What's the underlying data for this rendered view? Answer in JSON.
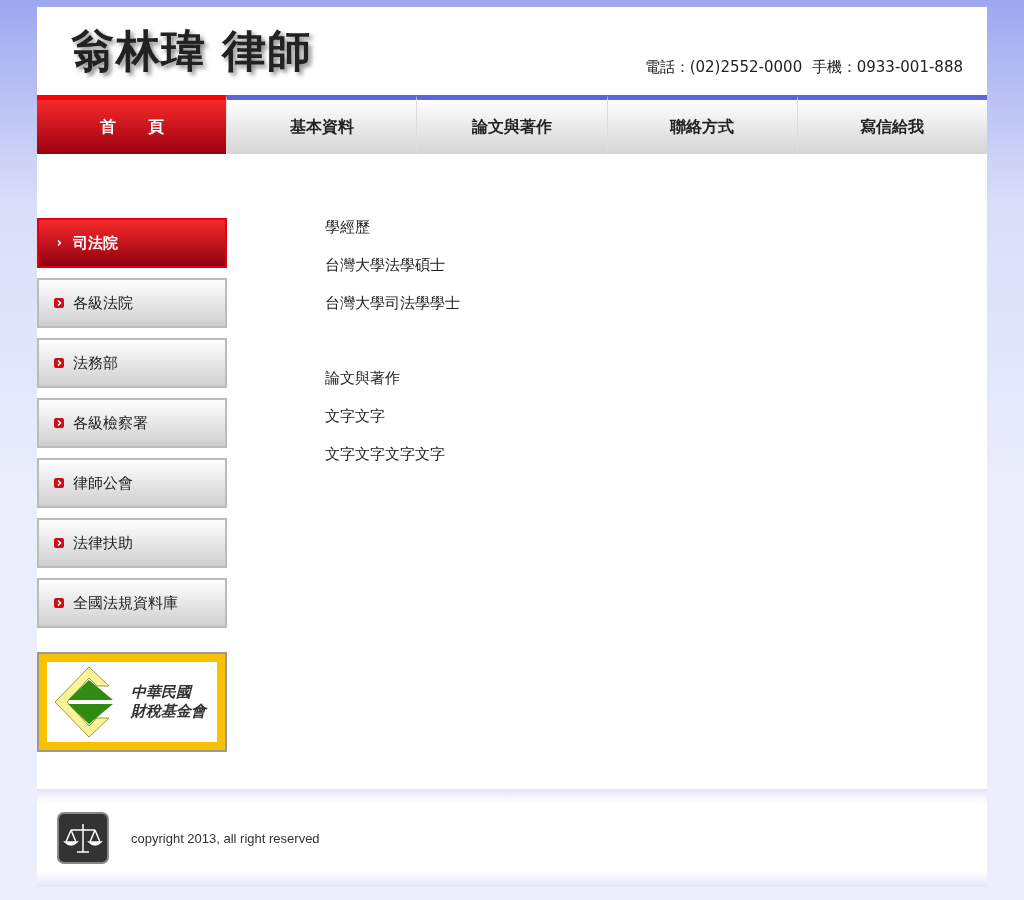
{
  "header": {
    "title": "翁林瑋 律師",
    "contact": "電話：(02)2552-0000  手機：0933-001-888"
  },
  "nav": [
    {
      "label": "首　　頁",
      "selected": true
    },
    {
      "label": "基本資料",
      "selected": false
    },
    {
      "label": "論文與著作",
      "selected": false
    },
    {
      "label": "聯絡方式",
      "selected": false
    },
    {
      "label": "寫信給我",
      "selected": false
    }
  ],
  "sidebar": {
    "items": [
      {
        "label": "司法院",
        "selected": true
      },
      {
        "label": "各級法院",
        "selected": false
      },
      {
        "label": "法務部",
        "selected": false
      },
      {
        "label": "各級檢察署",
        "selected": false
      },
      {
        "label": "律師公會",
        "selected": false
      },
      {
        "label": "法律扶助",
        "selected": false
      },
      {
        "label": "全國法規資料庫",
        "selected": false
      }
    ],
    "banner": {
      "lines": [
        "中華民國",
        "財稅基金會"
      ]
    }
  },
  "content": {
    "sections": [
      {
        "heading": "學經歷",
        "lines": [
          "台灣大學法學碩士",
          "台灣大學司法學學士"
        ]
      },
      {
        "heading": "論文與著作",
        "lines": [
          "文字文字",
          "文字文字文字文字"
        ]
      }
    ]
  },
  "footer": {
    "copyright": "copyright 2013,  all right reserved"
  }
}
